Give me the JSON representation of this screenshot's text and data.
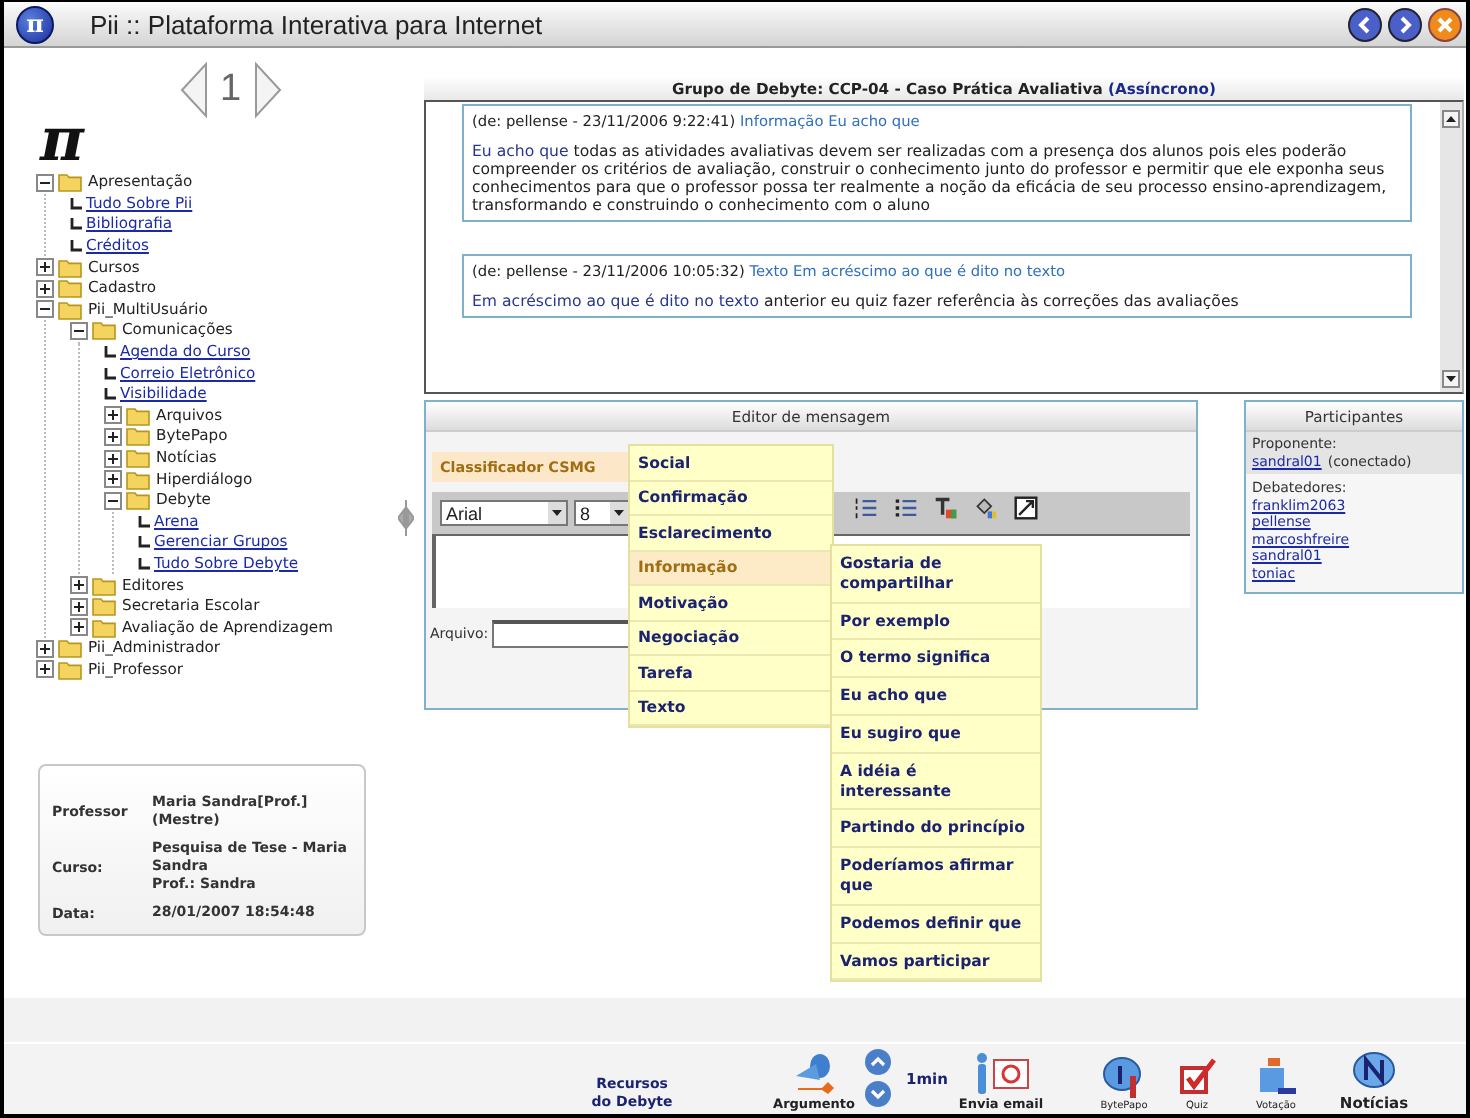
{
  "window": {
    "logo": "π",
    "title": "Pii :: Plataforma Interativa para Internet"
  },
  "pager": {
    "page": "1"
  },
  "sidebar": {
    "logo": "π"
  },
  "tree": [
    {
      "kind": "folder",
      "label": "Apresentação",
      "expanded": true,
      "children": [
        {
          "kind": "link",
          "label": "Tudo Sobre Pii"
        },
        {
          "kind": "link",
          "label": "Bibliografia"
        },
        {
          "kind": "link",
          "label": "Créditos"
        }
      ]
    },
    {
      "kind": "folder",
      "label": "Cursos",
      "expanded": false
    },
    {
      "kind": "folder",
      "label": "Cadastro",
      "expanded": false
    },
    {
      "kind": "folder",
      "label": "Pii_MultiUsuário",
      "expanded": true,
      "children": [
        {
          "kind": "folder",
          "label": "Comunicações",
          "expanded": true,
          "children": [
            {
              "kind": "link",
              "label": "Agenda do Curso"
            },
            {
              "kind": "link",
              "label": "Correio Eletrônico"
            },
            {
              "kind": "link",
              "label": "Visibilidade"
            },
            {
              "kind": "folder",
              "label": "Arquivos",
              "expanded": false
            },
            {
              "kind": "folder",
              "label": "BytePapo",
              "expanded": false
            },
            {
              "kind": "folder",
              "label": "Notícias",
              "expanded": false
            },
            {
              "kind": "folder",
              "label": "Hiperdiálogo",
              "expanded": false
            },
            {
              "kind": "folder",
              "label": "Debyte",
              "expanded": true,
              "children": [
                {
                  "kind": "link",
                  "label": "Arena"
                },
                {
                  "kind": "link",
                  "label": "Gerenciar Grupos"
                },
                {
                  "kind": "link",
                  "label": "Tudo Sobre Debyte"
                }
              ]
            }
          ]
        },
        {
          "kind": "folder",
          "label": "Editores",
          "expanded": false
        },
        {
          "kind": "folder",
          "label": "Secretaria Escolar",
          "expanded": false
        },
        {
          "kind": "folder",
          "label": "Avaliação de Aprendizagem",
          "expanded": false
        }
      ]
    },
    {
      "kind": "folder",
      "label": "Pii_Administrador",
      "expanded": false
    },
    {
      "kind": "folder",
      "label": "Pii_Professor",
      "expanded": false
    }
  ],
  "info_card": {
    "rows": [
      {
        "label": "Professor",
        "lines": [
          "Maria Sandra[Prof.] (Mestre)"
        ]
      },
      {
        "label": "Curso:",
        "lines": [
          "Pesquisa de Tese - Maria Sandra",
          "Prof.: Sandra"
        ]
      },
      {
        "label": "Data:",
        "lines": [
          "28/01/2007 18:54:48"
        ]
      }
    ]
  },
  "discussion": {
    "title": "Grupo de Debyte: CCP-04 - Caso Prática Avaliativa",
    "mode": "(Assíncrono)",
    "messages": [
      {
        "header": "(de: pellense - 23/11/2006 9:22:41)",
        "tag": "Informação Eu acho que",
        "body_lead": "Eu acho que",
        "body": "todas as atividades avaliativas devem ser realizadas com a presença dos alunos pois eles poderão compreender os critérios de avaliação, construir o conhecimento junto do professor e permitir que ele exponha seus conhecimentos para que o professor possa ter realmente a noção da eficácia de seu processo ensino-aprendizagem, transformando e construindo o conhecimento com o aluno"
      },
      {
        "header": "(de: pellense - 23/11/2006 10:05:32)",
        "tag": "Texto Em acréscimo ao que é dito no texto",
        "body_lead": "Em acréscimo ao que é dito no texto",
        "body": "anterior eu quiz fazer referência às correções das avaliações"
      }
    ]
  },
  "editor": {
    "title": "Editor de mensagem",
    "classifier": "Classificador CSMG",
    "font": "Arial",
    "size": "8",
    "file_label": "Arquivo:"
  },
  "participants": {
    "title": "Participantes",
    "proponent_label": "Proponente:",
    "proponent": "sandral01",
    "proponent_status": "(conectado)",
    "debaters_label": "Debatedores:",
    "debaters": [
      "franklim2063",
      "pellense",
      "marcoshfreire",
      "sandral01",
      "toniac"
    ]
  },
  "classifier_menu": {
    "items": [
      {
        "label": "Social",
        "selected": false
      },
      {
        "label": "Confirmação",
        "selected": false
      },
      {
        "label": "Esclarecimento",
        "selected": false
      },
      {
        "label": "Informação",
        "selected": true
      },
      {
        "label": "Motivação",
        "selected": false
      },
      {
        "label": "Negociação",
        "selected": false
      },
      {
        "label": "Tarefa",
        "selected": false
      },
      {
        "label": "Texto",
        "selected": false
      }
    ],
    "submenu": [
      "Gostaria de compartilhar",
      "Por exemplo",
      "O termo significa",
      "Eu acho que",
      "Eu sugiro que",
      "A idéia é interessante",
      "Partindo do princípio",
      "Poderíamos afirmar que",
      "Podemos definir que",
      "Vamos participar"
    ]
  },
  "footer": {
    "items": [
      {
        "kind": "heading",
        "label": "Recursos do Debyte"
      },
      {
        "kind": "argument",
        "label": "Argumento"
      },
      {
        "kind": "scroll"
      },
      {
        "kind": "timer",
        "label": "1min"
      },
      {
        "kind": "email",
        "label": "Envia email"
      },
      {
        "kind": "chat",
        "label": "BytePapo"
      },
      {
        "kind": "quiz",
        "label": "Quiz"
      },
      {
        "kind": "vote",
        "label": "Votação"
      },
      {
        "kind": "news",
        "label": "Notícias"
      }
    ]
  }
}
